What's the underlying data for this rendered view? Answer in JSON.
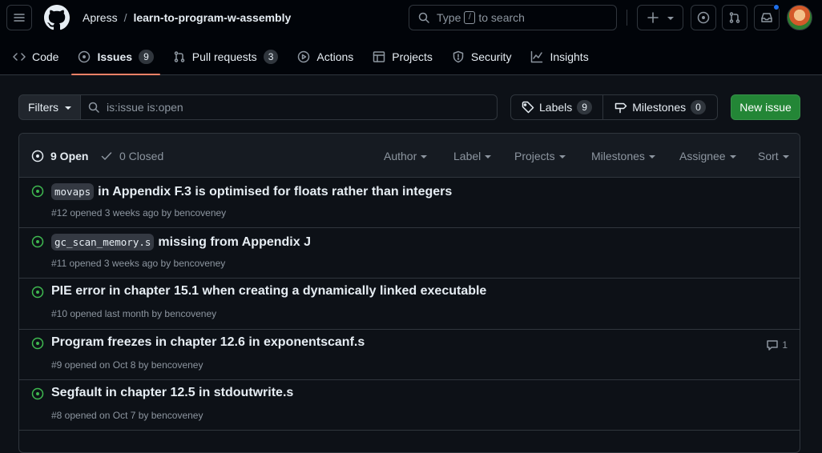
{
  "header": {
    "owner": "Apress",
    "separator": "/",
    "repo": "learn-to-program-w-assembly",
    "search": {
      "prefix": "Type",
      "key": "/",
      "suffix": "to search"
    }
  },
  "nav": {
    "tabs": [
      {
        "label": "Code"
      },
      {
        "label": "Issues",
        "count": "9"
      },
      {
        "label": "Pull requests",
        "count": "3"
      },
      {
        "label": "Actions"
      },
      {
        "label": "Projects"
      },
      {
        "label": "Security"
      },
      {
        "label": "Insights"
      }
    ]
  },
  "toolbar": {
    "filters_label": "Filters",
    "search_value": "is:issue is:open",
    "labels_label": "Labels",
    "labels_count": "9",
    "milestones_label": "Milestones",
    "milestones_count": "0",
    "new_issue_label": "New issue"
  },
  "list": {
    "open_label": "9 Open",
    "closed_label": "0 Closed",
    "filters": [
      "Author",
      "Label",
      "Projects",
      "Milestones",
      "Assignee",
      "Sort"
    ],
    "issues": [
      {
        "code": "movaps",
        "title": "in Appendix F.3 is optimised for floats rather than integers",
        "meta": "#12 opened 3 weeks ago by bencoveney"
      },
      {
        "code": "gc_scan_memory.s",
        "title": "missing from Appendix J",
        "meta": "#11 opened 3 weeks ago by bencoveney"
      },
      {
        "title": "PIE error in chapter 15.1 when creating a dynamically linked executable",
        "meta": "#10 opened last month by bencoveney"
      },
      {
        "title": "Program freezes in chapter 12.6 in exponentscanf.s",
        "meta": "#9 opened on Oct 8 by bencoveney",
        "comments": "1"
      },
      {
        "title": "Segfault in chapter 12.5 in stdoutwrite.s",
        "meta": "#8 opened on Oct 7 by bencoveney"
      }
    ]
  },
  "colors": {
    "accent": "#f78166",
    "open_green": "#3fb950",
    "button_green": "#238636",
    "notification": "#1f6feb"
  },
  "icons": [
    "hamburger-icon",
    "github-logo-icon",
    "search-icon",
    "plus-icon",
    "issue-icon",
    "pull-request-icon",
    "inbox-icon",
    "code-icon",
    "play-icon",
    "table-icon",
    "shield-icon",
    "graph-icon",
    "tag-icon",
    "milestone-icon",
    "check-icon",
    "comment-icon"
  ]
}
